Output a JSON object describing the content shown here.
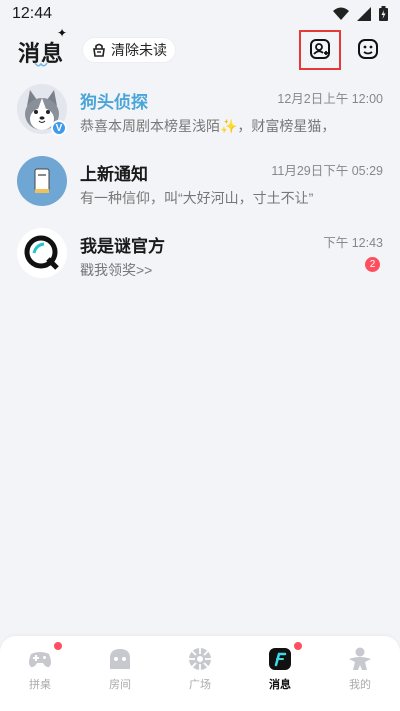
{
  "status_bar": {
    "time": "12:44",
    "icons": [
      "wifi-icon",
      "signal-icon",
      "battery-icon"
    ]
  },
  "header": {
    "title": "消息",
    "clear_unread_label": "清除未读",
    "icons": [
      "broom-icon",
      "add-friend-icon",
      "robot-face-icon"
    ]
  },
  "messages": [
    {
      "name": "狗头侦探",
      "preview": "恭喜本周剧本榜星浅陌✨，财富榜星猫，",
      "time": "12月2日上午 12:00",
      "avatar": "husky-avatar",
      "verified": true,
      "badge": ""
    },
    {
      "name": "上新通知",
      "preview": "有一种信仰，叫“大好河山，寸土不让”",
      "time": "11月29日下午 05:29",
      "avatar": "book-avatar",
      "verified": false,
      "badge": ""
    },
    {
      "name": "我是谜官方",
      "preview": "戳我领奖>>",
      "time": "下午 12:43",
      "avatar": "q-logo-avatar",
      "verified": false,
      "badge": "2"
    }
  ],
  "tabbar": {
    "active": "消息",
    "tabs": [
      {
        "label": "拼桌",
        "icon": "gamepad-icon",
        "dot": true
      },
      {
        "label": "房间",
        "icon": "house-icon",
        "dot": false
      },
      {
        "label": "广场",
        "icon": "ball-icon",
        "dot": false
      },
      {
        "label": "消息",
        "icon": "message-icon",
        "dot": true
      },
      {
        "label": "我的",
        "icon": "meeple-icon",
        "dot": false
      }
    ]
  },
  "colors": {
    "background": "#f3f4f8",
    "accent_blue": "#4aa5d8",
    "badge_red": "#ff4f5e",
    "highlight_box": "#e53935"
  }
}
